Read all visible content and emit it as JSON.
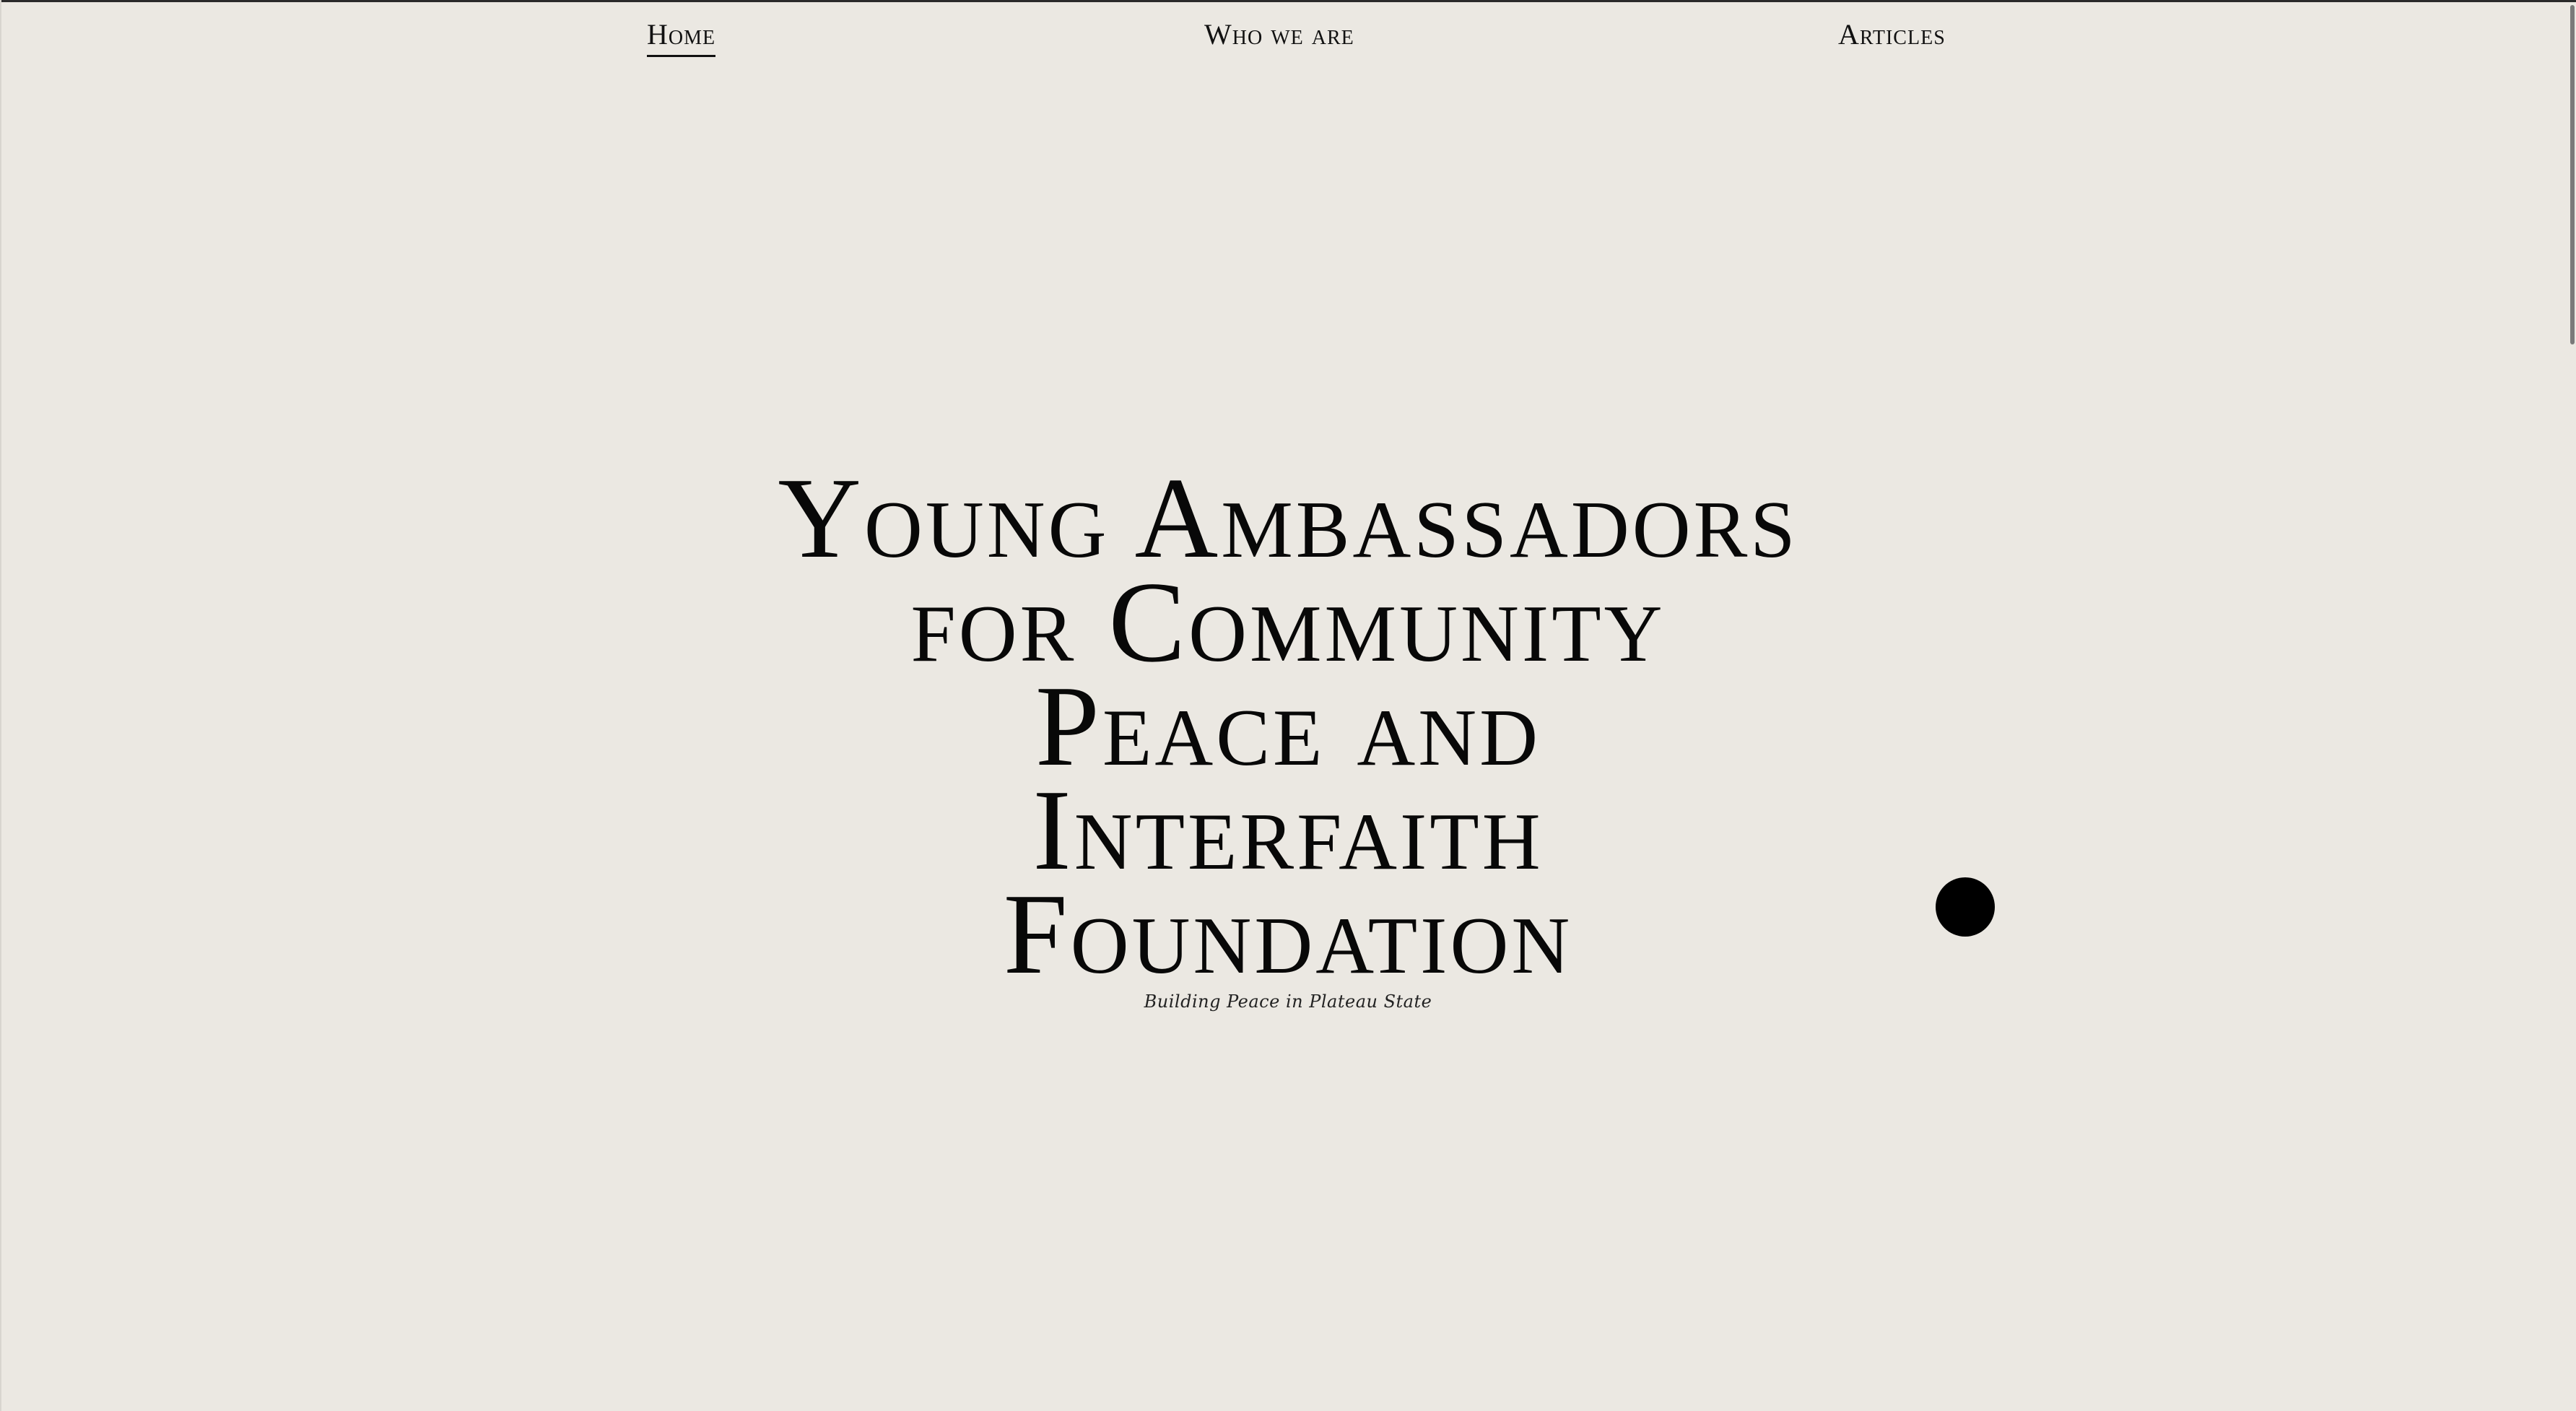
{
  "nav": {
    "home": "Home",
    "who_we_are": "Who we are",
    "articles": "Articles"
  },
  "hero": {
    "title_lines": [
      "Young Ambassadors",
      "for Community",
      "Peace and",
      "Interfaith",
      "Foundation"
    ],
    "subtitle": "Building Peace in Plateau State"
  },
  "colors": {
    "background": "#ebe8e2",
    "text": "#0b0b0b",
    "dot": "#000000"
  }
}
